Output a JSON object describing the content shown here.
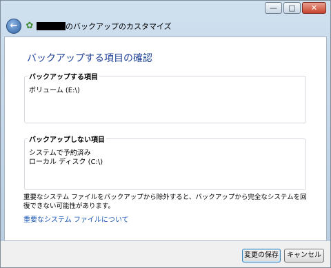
{
  "window": {
    "title": "のバックアップのカスタマイズ",
    "buttons": {
      "minimize": "—",
      "maximize": "□",
      "close": "✕"
    }
  },
  "content": {
    "heading": "バックアップする項目の確認",
    "backup_group": {
      "label": "バックアップする項目",
      "items": [
        "ボリューム (E:\\)"
      ]
    },
    "exclude_group": {
      "label": "バックアップしない項目",
      "items": [
        "システムで予約済み",
        "ローカル ディスク (C:\\)"
      ]
    },
    "note": "重要なシステム ファイルをバックアップから除外すると、バックアップから完全なシステムを回復できない可能性があります。",
    "link": "重要なシステム ファイルについて"
  },
  "footer": {
    "save_label": "変更の保存",
    "cancel_label": "キャンセル"
  },
  "colors": {
    "heading": "#1c3f95",
    "link": "#1a56b5",
    "chrome": "#b9cde0"
  }
}
